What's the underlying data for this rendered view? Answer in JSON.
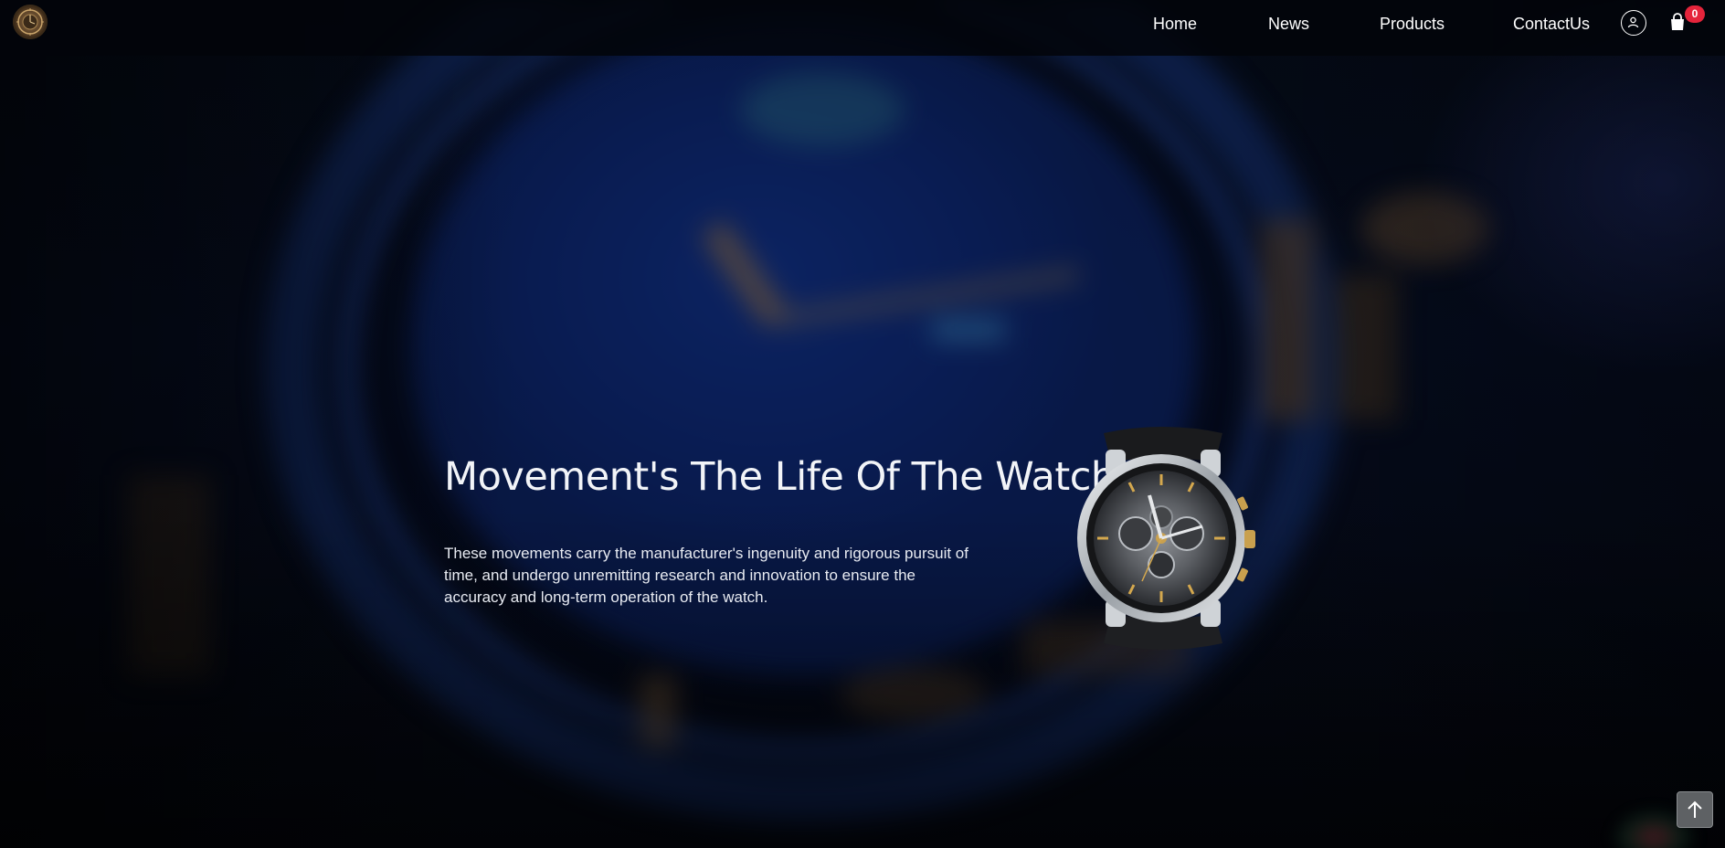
{
  "header": {
    "nav": {
      "home": "Home",
      "news": "News",
      "products": "Products",
      "contact": "ContactUs"
    },
    "cart_count": "0"
  },
  "hero": {
    "title": "Movement's The Life Of The Watch",
    "description": "These movements carry the manufacturer's ingenuity and rigorous pursuit of time, and undergo unremitting research and innovation to ensure the accuracy and long-term operation of the watch."
  },
  "icons": {
    "logo": "watch-emblem-logo",
    "user": "user-icon",
    "cart": "shopping-bag-icon",
    "back_to_top": "arrow-up-icon"
  },
  "colors": {
    "badge": "#e5243b",
    "header_bg": "#02040a",
    "text": "#ffffff"
  }
}
